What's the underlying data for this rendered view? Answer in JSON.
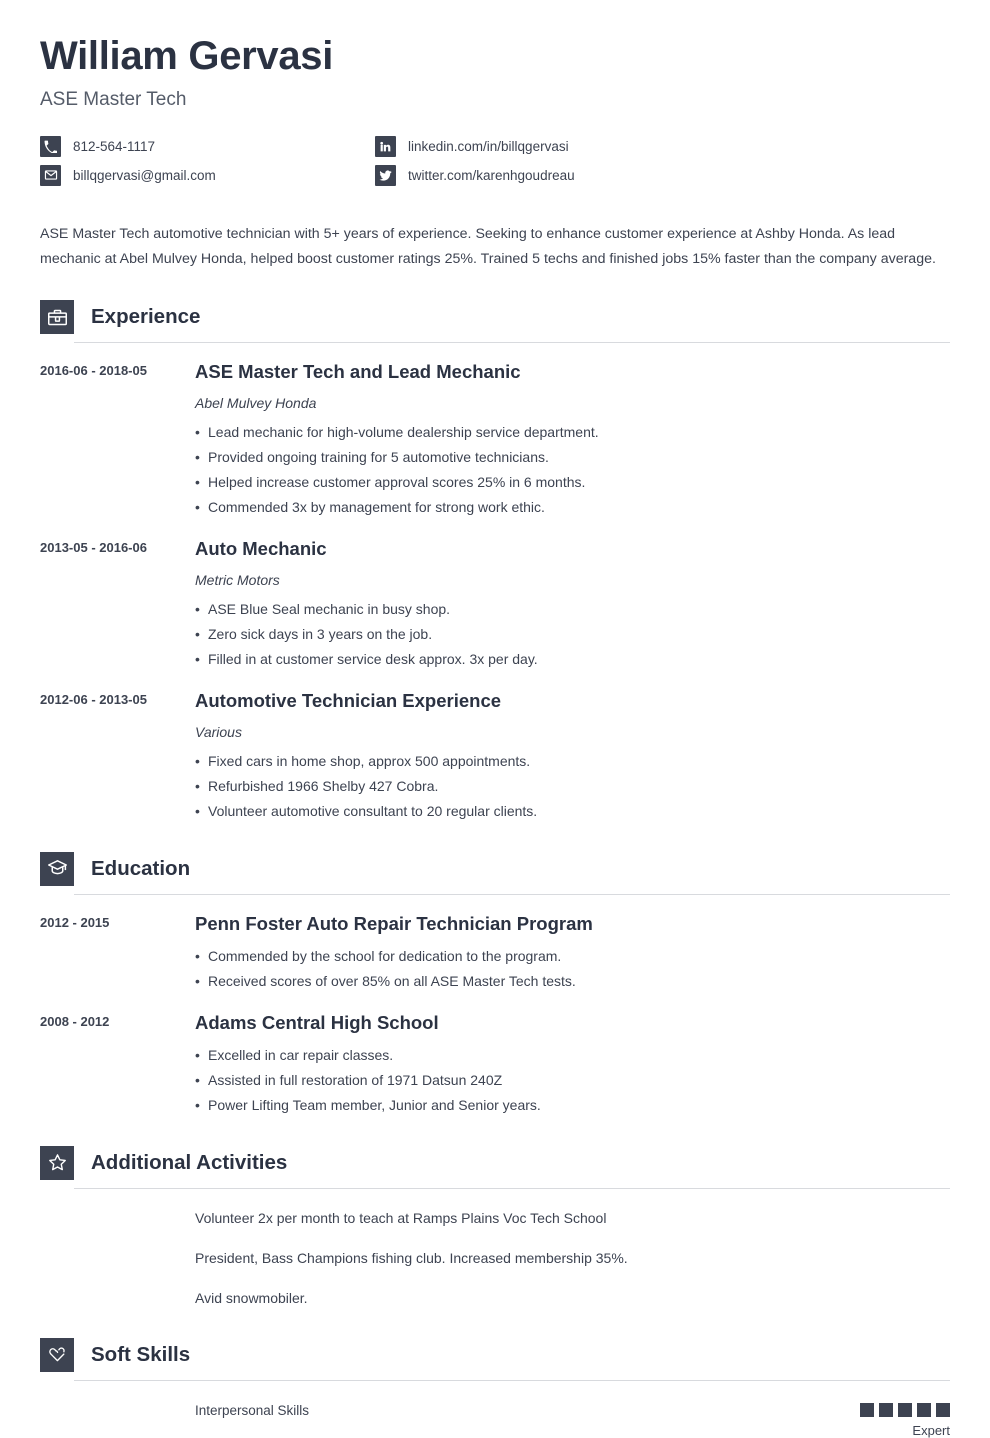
{
  "theme": {
    "accent": "#3d4351",
    "heading": "#2b3242",
    "body_text": "#3d4351",
    "rule": "#d8dade",
    "background": "#ffffff"
  },
  "header": {
    "name": "William Gervasi",
    "job_title": "ASE Master Tech",
    "contacts": [
      {
        "icon": "phone-icon",
        "text": "812-564-1117"
      },
      {
        "icon": "linkedin-icon",
        "text": "linkedin.com/in/billqgervasi"
      },
      {
        "icon": "email-icon",
        "text": "billqgervasi@gmail.com"
      },
      {
        "icon": "twitter-icon",
        "text": "twitter.com/karenhgoudreau"
      }
    ]
  },
  "summary": "ASE Master Tech automotive technician with 5+ years of experience. Seeking to enhance customer experience at Ashby Honda. As lead mechanic at Abel Mulvey Honda, helped boost customer ratings 25%. Trained 5 techs and finished jobs 15% faster than the company average.",
  "sections": {
    "experience": {
      "title": "Experience",
      "icon": "briefcase-icon",
      "entries": [
        {
          "date": "2016-06 - 2018-05",
          "title": "ASE Master Tech and Lead Mechanic",
          "subtitle": "Abel Mulvey Honda",
          "bullets": [
            "Lead mechanic for high-volume dealership service department.",
            "Provided ongoing training for 5 automotive technicians.",
            "Helped increase customer approval scores 25% in 6 months.",
            "Commended 3x by management for strong work ethic."
          ]
        },
        {
          "date": "2013-05 - 2016-06",
          "title": "Auto Mechanic",
          "subtitle": "Metric Motors",
          "bullets": [
            "ASE Blue Seal mechanic in busy shop.",
            "Zero sick days in 3 years on the job.",
            "Filled in at customer service desk approx. 3x per day."
          ]
        },
        {
          "date": "2012-06 - 2013-05",
          "title": "Automotive Technician Experience",
          "subtitle": "Various",
          "bullets": [
            "Fixed cars in home shop, approx 500 appointments.",
            "Refurbished 1966 Shelby 427 Cobra.",
            "Volunteer automotive consultant to 20 regular clients."
          ]
        }
      ]
    },
    "education": {
      "title": "Education",
      "icon": "graduation-cap-icon",
      "entries": [
        {
          "date": "2012 - 2015",
          "title": "Penn Foster Auto Repair Technician Program",
          "subtitle": "",
          "bullets": [
            "Commended by the school for dedication to the program.",
            "Received scores of over 85% on all ASE Master Tech tests."
          ]
        },
        {
          "date": "2008 - 2012",
          "title": "Adams Central High School",
          "subtitle": "",
          "bullets": [
            "Excelled in car repair classes.",
            "Assisted in full restoration of 1971 Datsun 240Z",
            "Power Lifting Team member, Junior and Senior years."
          ]
        }
      ]
    },
    "activities": {
      "title": "Additional Activities",
      "icon": "star-icon",
      "lines": [
        "Volunteer 2x per month to teach at Ramps Plains Voc Tech School",
        "President, Bass Champions fishing club. Increased membership 35%.",
        "Avid snowmobiler."
      ]
    },
    "soft_skills": {
      "title": "Soft Skills",
      "icon": "heart-hands-icon",
      "skills": [
        {
          "name": "Interpersonal Skills",
          "level": "Expert",
          "filled": 5,
          "total": 5
        }
      ]
    }
  }
}
